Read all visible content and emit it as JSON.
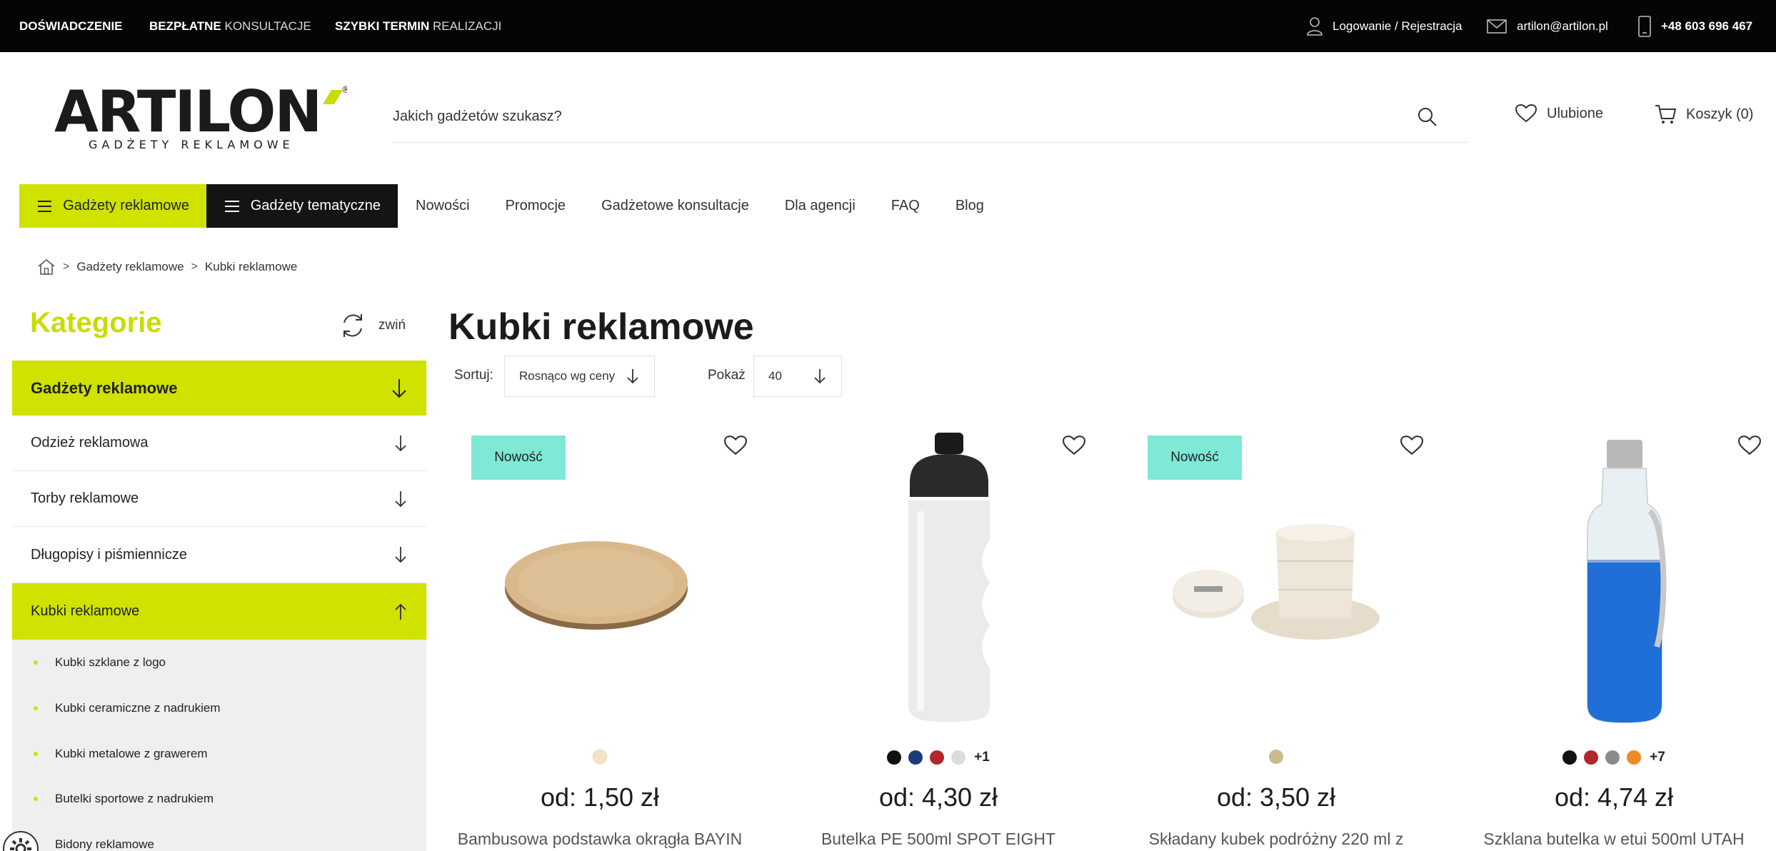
{
  "topbar": {
    "item1_bold": "DOŚWIADCZENIE",
    "item2_bold": "BEZPŁATNE",
    "item2_light": "KONSULTACJE",
    "item3_bold": "SZYBKI TERMIN",
    "item3_light": "REALIZACJI",
    "login": "Logowanie / Rejestracja",
    "email": "artilon@artilon.pl",
    "phone": "+48 603 696 467"
  },
  "logo": {
    "name": "ARTILON",
    "tagline": "GADŻETY REKLAMOWE"
  },
  "search": {
    "placeholder": "Jakich gadżetów szukasz?"
  },
  "header": {
    "favorites": "Ulubione",
    "cart": "Koszyk (0)"
  },
  "nav": {
    "btn_promo": "Gadżety reklamowe",
    "btn_thematic": "Gadżety tematyczne",
    "links": [
      "Nowości",
      "Promocje",
      "Gadżetowe konsultacje",
      "Dla agencji",
      "FAQ",
      "Blog"
    ]
  },
  "breadcrumb": {
    "level1": "Gadżety reklamowe",
    "level2": "Kubki reklamowe"
  },
  "sidebar": {
    "title": "Kategorie",
    "collapse": "zwiń",
    "categories": [
      "Gadżety reklamowe",
      "Odzież reklamowa",
      "Torby reklamowe",
      "Długopisy i piśmiennicze",
      "Kubki reklamowe"
    ],
    "subcategories": [
      "Kubki szklane z logo",
      "Kubki ceramiczne z nadrukiem",
      "Kubki metalowe z grawerem",
      "Butelki sportowe z nadrukiem",
      "Bidony reklamowe"
    ]
  },
  "main": {
    "title": "Kubki reklamowe",
    "sort_label": "Sortuj:",
    "sort_value": "Rosnąco wg ceny",
    "show_label": "Pokaż",
    "show_value": "40"
  },
  "products": [
    {
      "badge": "Nowość",
      "price": "od: 1,50 zł",
      "name": "Bambusowa podstawka okrągła BAYIN",
      "colors": [
        "#f3e3c7"
      ],
      "more": ""
    },
    {
      "badge": "",
      "price": "od: 4,30 zł",
      "name": "Butelka PE 500ml SPOT EIGHT",
      "colors": [
        "#111111",
        "#1f3a78",
        "#b3262b",
        "#dcdcdc"
      ],
      "more": "+1"
    },
    {
      "badge": "Nowość",
      "price": "od: 3,50 zł",
      "name": "Składany kubek podróżny 220 ml z",
      "colors": [
        "#c8ba8a"
      ],
      "more": ""
    },
    {
      "badge": "",
      "price": "od: 4,74 zł",
      "name": "Szklana butelka w etui 500ml UTAH",
      "colors": [
        "#111111",
        "#b3262b",
        "#8a8a8a",
        "#f08a24"
      ],
      "more": "+7"
    }
  ]
}
